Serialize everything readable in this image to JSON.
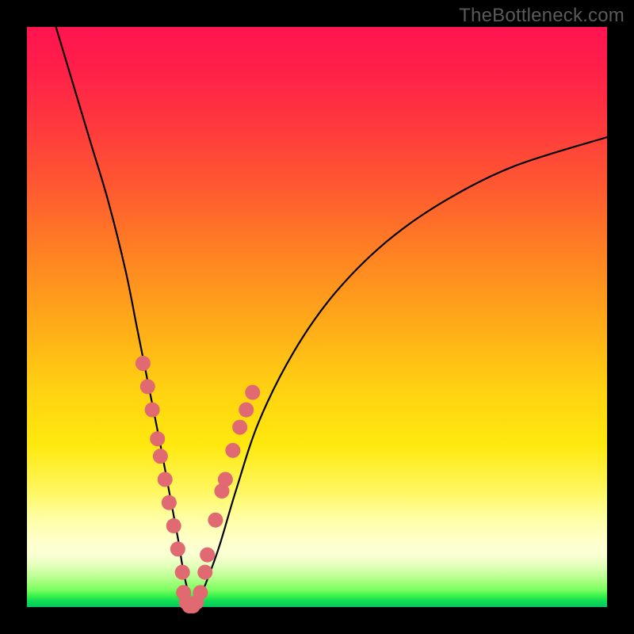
{
  "watermark": "TheBottleneck.com",
  "chart_data": {
    "type": "line",
    "title": "",
    "xlabel": "",
    "ylabel": "",
    "xlim": [
      0,
      100
    ],
    "ylim": [
      0,
      100
    ],
    "grid": false,
    "legend": false,
    "series": [
      {
        "name": "bottleneck-curve",
        "x": [
          5,
          8,
          11,
          14,
          17,
          19,
          21,
          23,
          24.5,
          26,
          27,
          28,
          29,
          30,
          33,
          36,
          40,
          46,
          53,
          62,
          72,
          84,
          100
        ],
        "y": [
          100,
          90,
          80,
          70,
          58,
          48,
          38,
          28,
          20,
          12,
          6,
          2,
          0.2,
          2,
          10,
          20,
          32,
          44,
          54,
          63,
          70,
          76,
          81
        ]
      }
    ],
    "markers": {
      "name": "highlight-dots",
      "color": "#e06972",
      "points": [
        {
          "x": 20.0,
          "y": 42
        },
        {
          "x": 20.8,
          "y": 38
        },
        {
          "x": 21.6,
          "y": 34
        },
        {
          "x": 22.5,
          "y": 29
        },
        {
          "x": 23.0,
          "y": 26
        },
        {
          "x": 23.8,
          "y": 22
        },
        {
          "x": 24.5,
          "y": 18
        },
        {
          "x": 25.3,
          "y": 14
        },
        {
          "x": 26.0,
          "y": 10
        },
        {
          "x": 26.8,
          "y": 6
        },
        {
          "x": 27.0,
          "y": 2.5
        },
        {
          "x": 27.5,
          "y": 0.8
        },
        {
          "x": 28.0,
          "y": 0.2
        },
        {
          "x": 28.6,
          "y": 0.2
        },
        {
          "x": 29.2,
          "y": 0.8
        },
        {
          "x": 29.9,
          "y": 2.5
        },
        {
          "x": 30.7,
          "y": 6
        },
        {
          "x": 31.1,
          "y": 9
        },
        {
          "x": 32.5,
          "y": 15
        },
        {
          "x": 33.6,
          "y": 20
        },
        {
          "x": 34.2,
          "y": 22
        },
        {
          "x": 35.5,
          "y": 27
        },
        {
          "x": 36.7,
          "y": 31
        },
        {
          "x": 37.8,
          "y": 34
        },
        {
          "x": 38.9,
          "y": 37
        }
      ]
    }
  }
}
